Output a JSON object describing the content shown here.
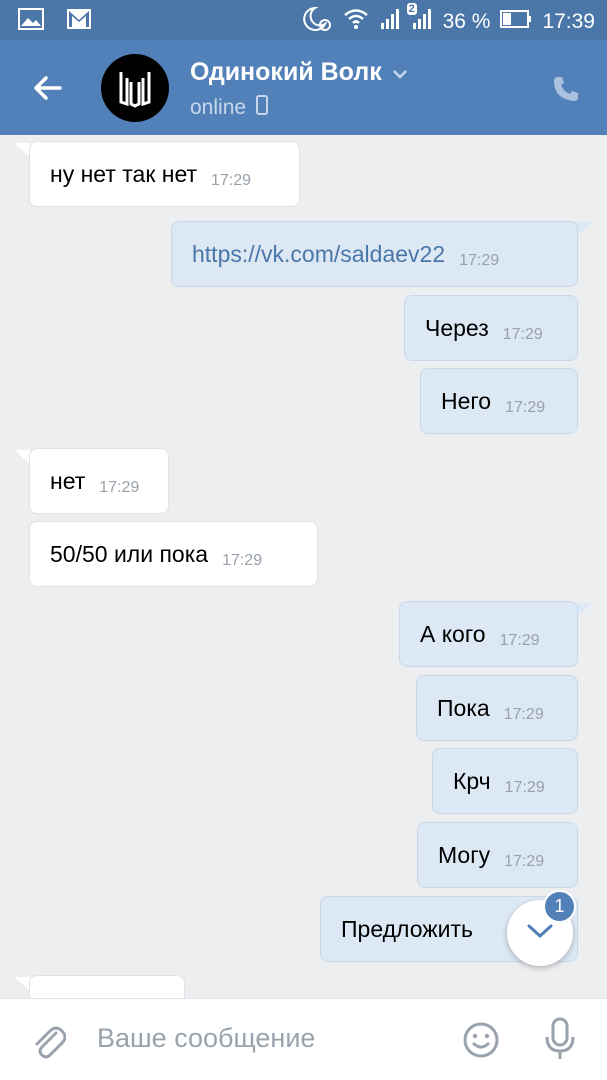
{
  "status_bar": {
    "battery": "36 %",
    "time": "17:39",
    "sim_badge": "2"
  },
  "header": {
    "name": "Одинокий Волк",
    "status": "online"
  },
  "messages": [
    {
      "dir": "in",
      "text": "ну нет так нет",
      "time": "17:29"
    },
    {
      "dir": "out",
      "text": "https://vk.com/saldaev22",
      "time": "17:29",
      "link": true
    },
    {
      "dir": "out",
      "text": "Через",
      "time": "17:29"
    },
    {
      "dir": "out",
      "text": "Него",
      "time": "17:29"
    },
    {
      "dir": "in",
      "text": "нет",
      "time": "17:29"
    },
    {
      "dir": "in",
      "text": "50/50 или пока",
      "time": "17:29"
    },
    {
      "dir": "out",
      "text": "А кого",
      "time": "17:29"
    },
    {
      "dir": "out",
      "text": "Пока",
      "time": "17:29"
    },
    {
      "dir": "out",
      "text": "Крч",
      "time": "17:29"
    },
    {
      "dir": "out",
      "text": "Могу",
      "time": "17:29"
    },
    {
      "dir": "out",
      "text": "Предложить",
      "time": ""
    }
  ],
  "scroll_button": {
    "badge": "1"
  },
  "composer": {
    "placeholder": "Ваше сообщение"
  },
  "colors": {
    "header": "#5181b8",
    "status_bar": "#4a76a8",
    "outgoing": "#dde8f5",
    "incoming": "#ffffff",
    "link": "#4a76a8"
  }
}
